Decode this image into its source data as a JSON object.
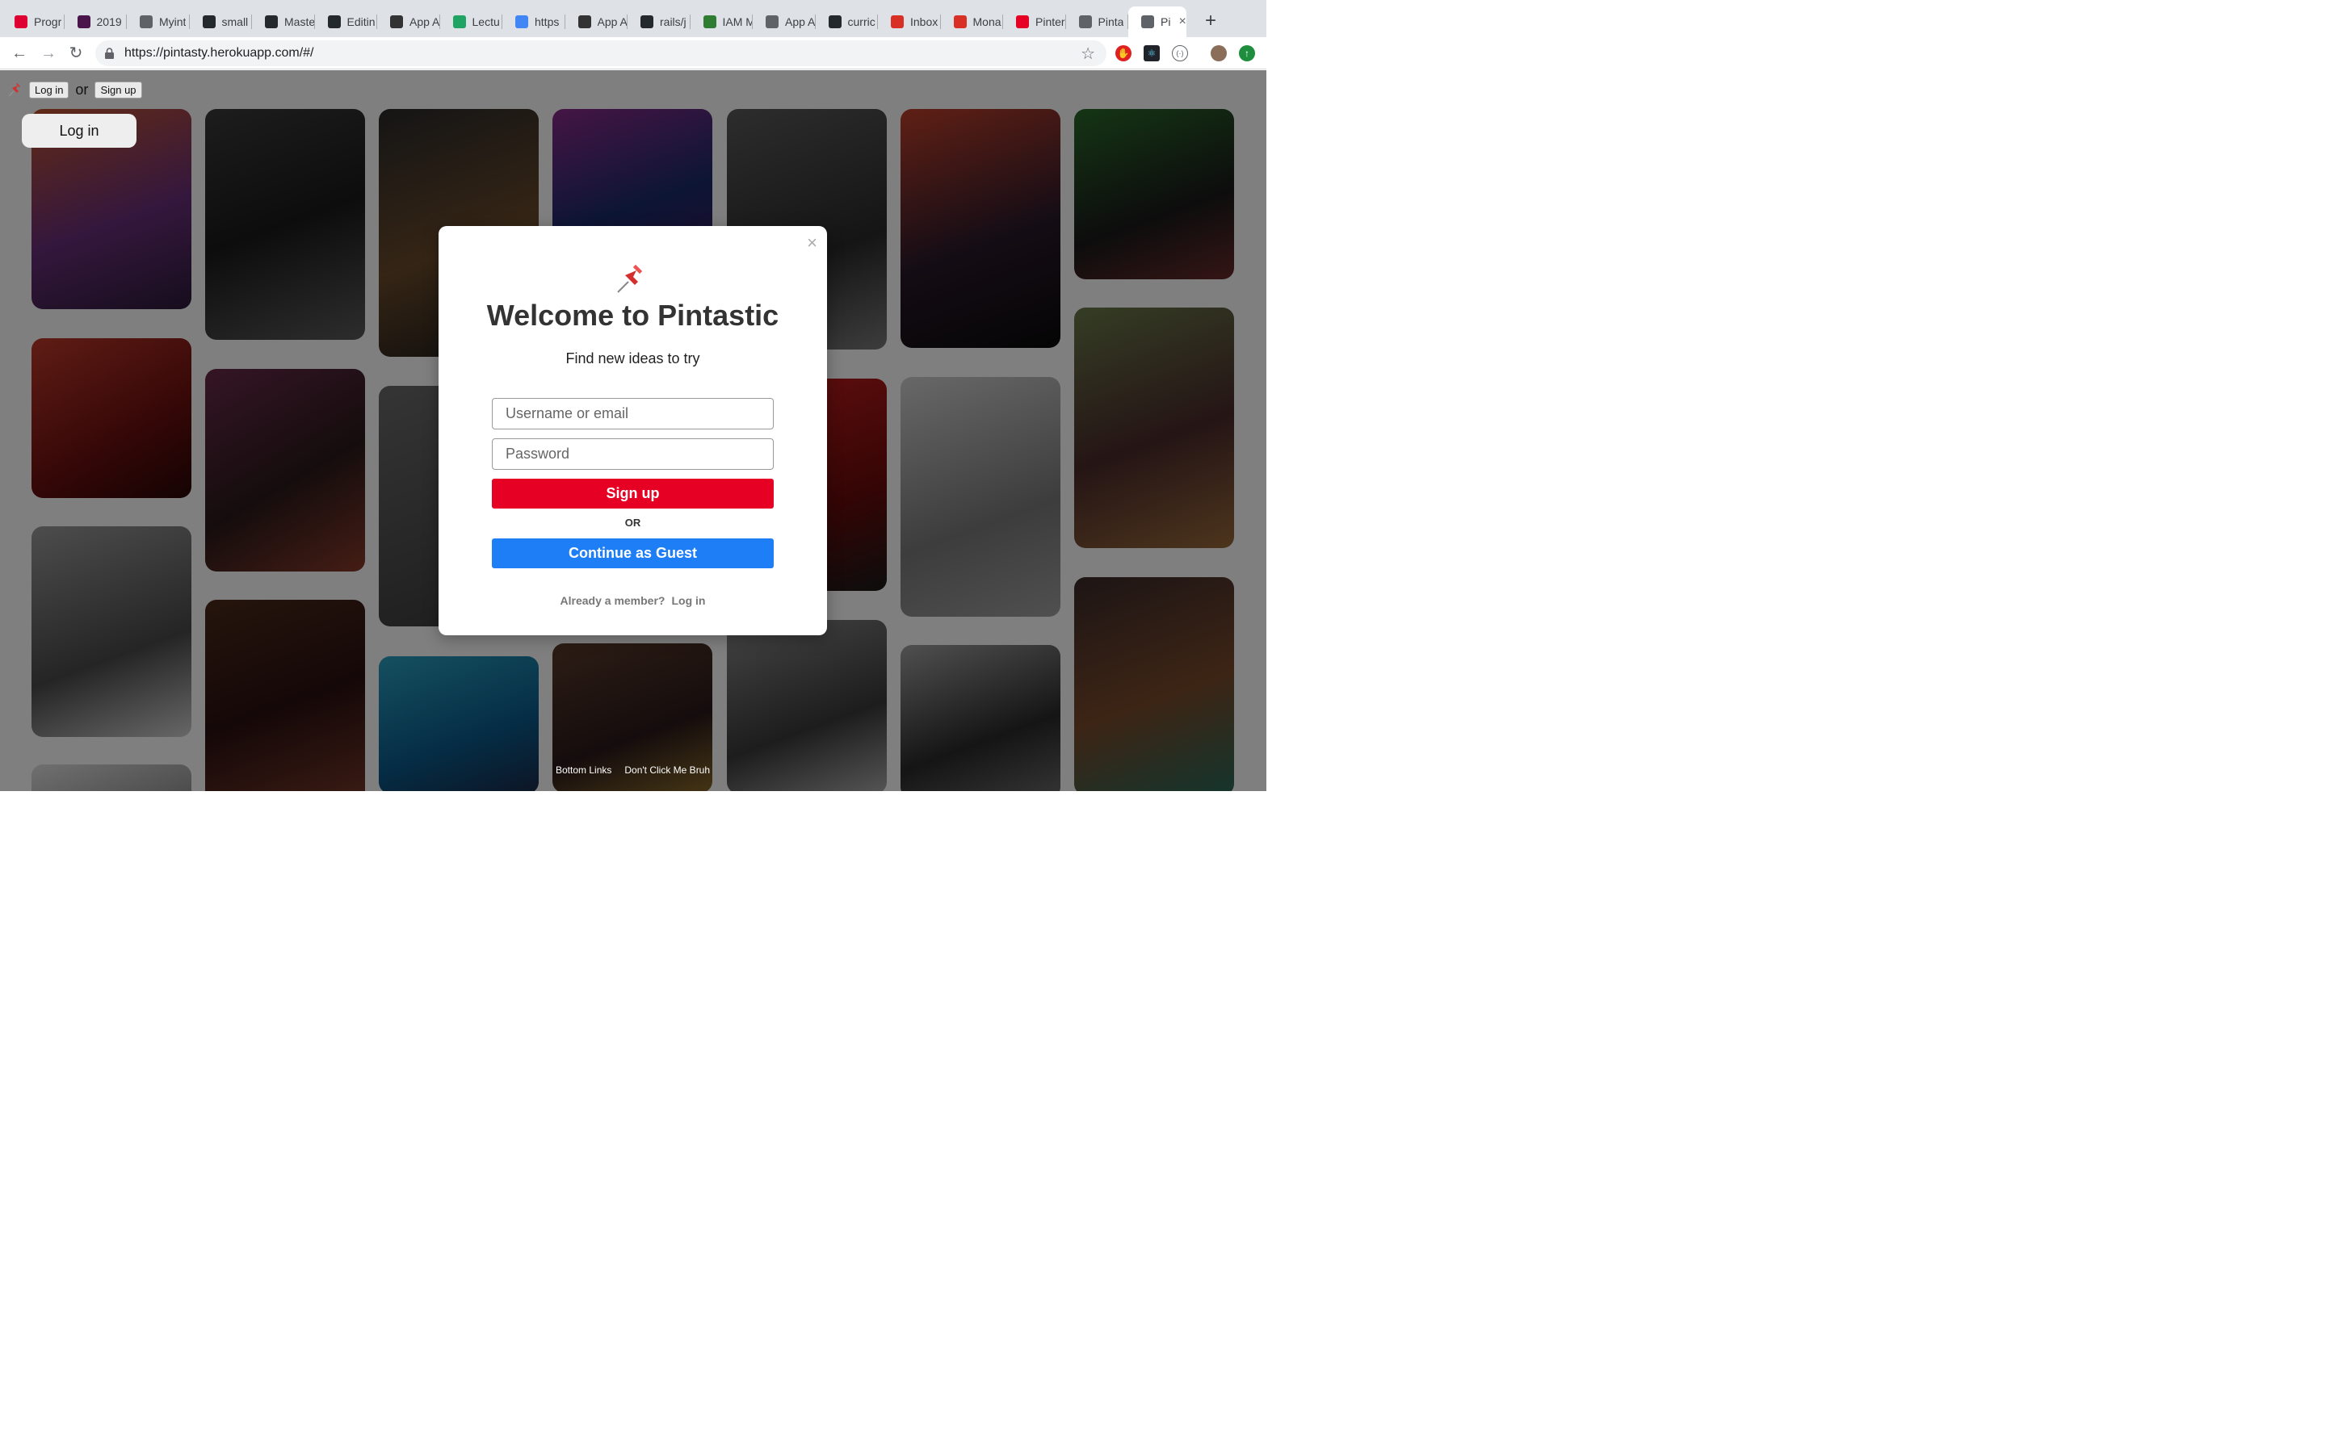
{
  "browser": {
    "tabs": [
      {
        "label": "Progr",
        "icon": "angular-icon",
        "color": "#dd0031"
      },
      {
        "label": "2019",
        "icon": "slack-icon",
        "color": "#4a154b"
      },
      {
        "label": "Myint",
        "icon": "doc-icon",
        "color": "#5f6368"
      },
      {
        "label": "small",
        "icon": "github-icon",
        "color": "#24292e"
      },
      {
        "label": "Maste",
        "icon": "github-icon",
        "color": "#24292e"
      },
      {
        "label": "Editin",
        "icon": "github-icon",
        "color": "#24292e"
      },
      {
        "label": "App A",
        "icon": "appacademy-icon",
        "color": "#333333"
      },
      {
        "label": "Lectu",
        "icon": "drive-icon",
        "color": "#1fa463"
      },
      {
        "label": "https",
        "icon": "calendar-icon",
        "color": "#4285f4"
      },
      {
        "label": "App A",
        "icon": "appacademy-icon",
        "color": "#333333"
      },
      {
        "label": "rails/j",
        "icon": "github-icon",
        "color": "#24292e"
      },
      {
        "label": "IAM M",
        "icon": "key-icon",
        "color": "#2e7d32"
      },
      {
        "label": "App A",
        "icon": "doc-icon",
        "color": "#5f6368"
      },
      {
        "label": "curric",
        "icon": "github-icon",
        "color": "#24292e"
      },
      {
        "label": "Inbox",
        "icon": "gmail-icon",
        "color": "#d93025"
      },
      {
        "label": "Mona",
        "icon": "gmail-icon",
        "color": "#d93025"
      },
      {
        "label": "Pinter",
        "icon": "pinterest-icon",
        "color": "#e60023"
      },
      {
        "label": "Pinta",
        "icon": "doc-icon",
        "color": "#5f6368"
      },
      {
        "label": "Pi",
        "icon": "doc-icon",
        "color": "#5f6368",
        "active": true
      }
    ],
    "url": "https://pintasty.herokuapp.com/#/"
  },
  "page": {
    "nav": {
      "login_label": "Log in",
      "or_label": "or",
      "signup_label": "Sign up"
    },
    "big_login_label": "Log in",
    "bottom_links": [
      "Bottom Links",
      "Don't Click Me Bruh"
    ]
  },
  "modal": {
    "close_symbol": "×",
    "title": "Welcome to Pintastic",
    "subtitle": "Find new ideas to try",
    "username_placeholder": "Username or email",
    "password_placeholder": "Password",
    "signup_label": "Sign up",
    "or_label": "OR",
    "guest_label": "Continue as Guest",
    "member_text": "Already a member?",
    "login_link": "Log in"
  },
  "colors": {
    "brand_red": "#e60023",
    "guest_blue": "#1e7ef6"
  }
}
